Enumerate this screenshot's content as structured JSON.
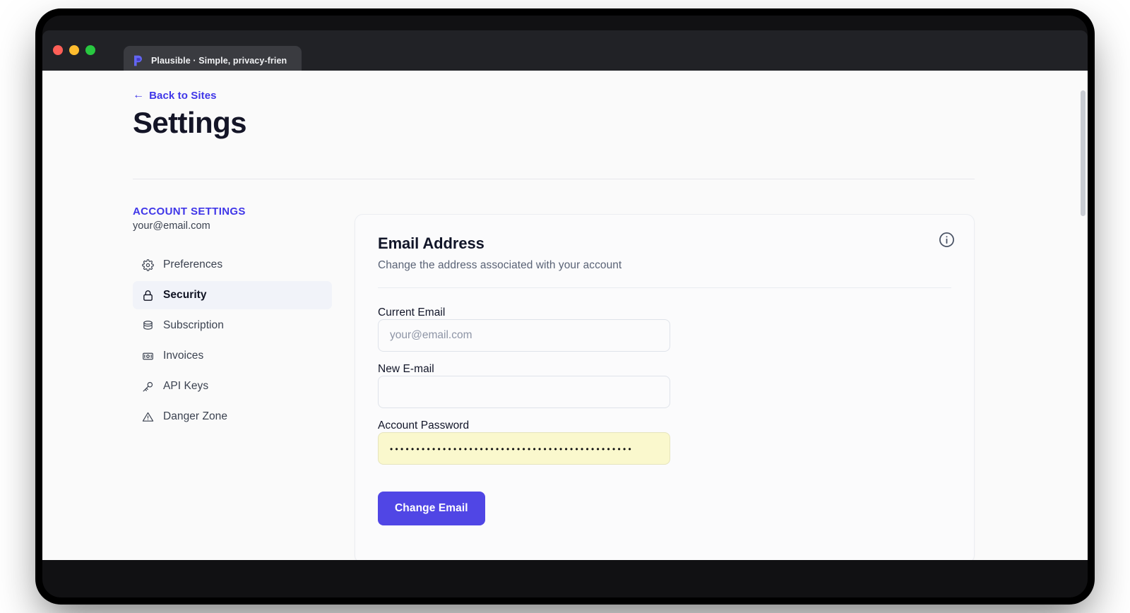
{
  "window": {
    "traffic_lights": [
      "close",
      "minimize",
      "maximize"
    ],
    "tab": {
      "favicon": "plausible-logo-icon",
      "title": "Plausible · Simple, privacy-frien"
    }
  },
  "header": {
    "back_link": "Back to Sites",
    "back_arrow": "←",
    "title": "Settings"
  },
  "sidebar": {
    "heading": "ACCOUNT SETTINGS",
    "email": "your@email.com",
    "items": [
      {
        "label": "Preferences",
        "icon": "gear-icon",
        "active": false
      },
      {
        "label": "Security",
        "icon": "lock-icon",
        "active": true
      },
      {
        "label": "Subscription",
        "icon": "stack-icon",
        "active": false
      },
      {
        "label": "Invoices",
        "icon": "banknote-icon",
        "active": false
      },
      {
        "label": "API Keys",
        "icon": "key-icon",
        "active": false
      },
      {
        "label": "Danger Zone",
        "icon": "warning-triangle-icon",
        "active": false
      }
    ]
  },
  "card": {
    "title": "Email Address",
    "subtitle": "Change the address associated with your account",
    "info_icon": "info-circle-icon",
    "fields": {
      "current_email": {
        "label": "Current Email",
        "value": "",
        "placeholder": "your@email.com"
      },
      "new_email": {
        "label": "New E-mail",
        "value": "",
        "placeholder": ""
      },
      "account_password": {
        "label": "Account Password",
        "value": "••••••••••••••••••••••••••••••••••••••••••••••",
        "placeholder": ""
      }
    },
    "submit_label": "Change Email"
  },
  "colors": {
    "accent": "#5046e5",
    "link": "#3f36e8",
    "autofill_yellow": "#faf8cd",
    "title_bar": "#212226",
    "page_bg": "#fafafa"
  }
}
